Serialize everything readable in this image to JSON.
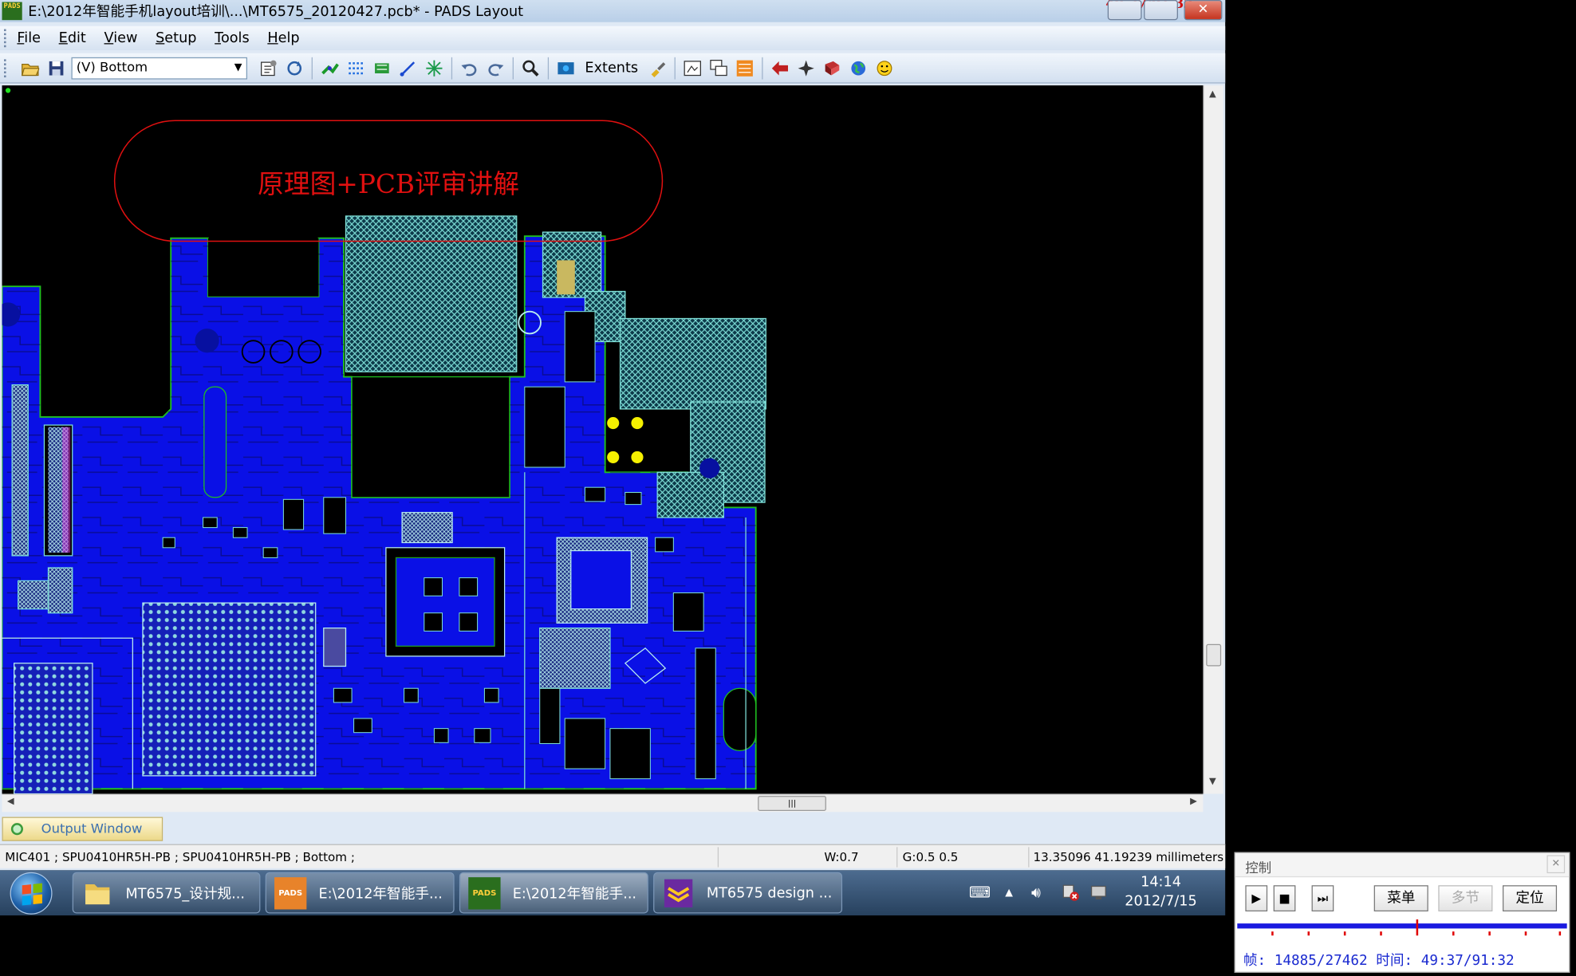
{
  "window": {
    "title": "E:\\2012年智能手机layout培训\\...\\MT6575_20120427.pcb* - PADS Layout",
    "app_icon_label": "PADS",
    "overlay_counter": "49:37/91:32"
  },
  "menu": {
    "items": [
      {
        "key": "F",
        "rest": "ile"
      },
      {
        "key": "E",
        "rest": "dit"
      },
      {
        "key": "V",
        "rest": "iew"
      },
      {
        "key": "S",
        "rest": "etup"
      },
      {
        "key": "T",
        "rest": "ools"
      },
      {
        "key": "H",
        "rest": "elp"
      }
    ]
  },
  "toolbar": {
    "layer_select": "(V) Bottom",
    "extents_label": "Extents"
  },
  "canvas": {
    "annotation_text": "原理图+PCB评审讲解",
    "colors": {
      "background": "#000000",
      "copper": "#0a10e6",
      "board_outline": "#20c020",
      "hatch": "#7fe0d8",
      "annotation_red": "#e01010",
      "pad_yellow": "#f5f000"
    }
  },
  "output_window": {
    "tab_label": "Output Window"
  },
  "status": {
    "selection": "MIC401 ; SPU0410HR5H-PB ; SPU0410HR5H-PB ; Bottom ;",
    "width": "W:0.7",
    "grid": "G:0.5 0.5",
    "x": "13.35096",
    "y": "41.19239",
    "units": "millimeters"
  },
  "taskbar": {
    "items": [
      {
        "label": "MT6575_设计规...",
        "icon": "folder-icon"
      },
      {
        "label": "E:\\2012年智能手...",
        "icon": "pads-icon"
      },
      {
        "label": "E:\\2012年智能手...",
        "icon": "pads-icon"
      },
      {
        "label": "MT6575 design ...",
        "icon": "document-viewer-icon"
      }
    ],
    "clock_time": "14:14",
    "clock_date": "2012/7/15"
  },
  "player": {
    "title": "控制",
    "menu_btn": "菜单",
    "sections_btn": "多节",
    "locate_btn": "定位",
    "frame_label": "帧:",
    "frame_value": "14885/27462",
    "time_label": "时间:",
    "time_value": "49:37/91:32",
    "progress": 0.542
  }
}
